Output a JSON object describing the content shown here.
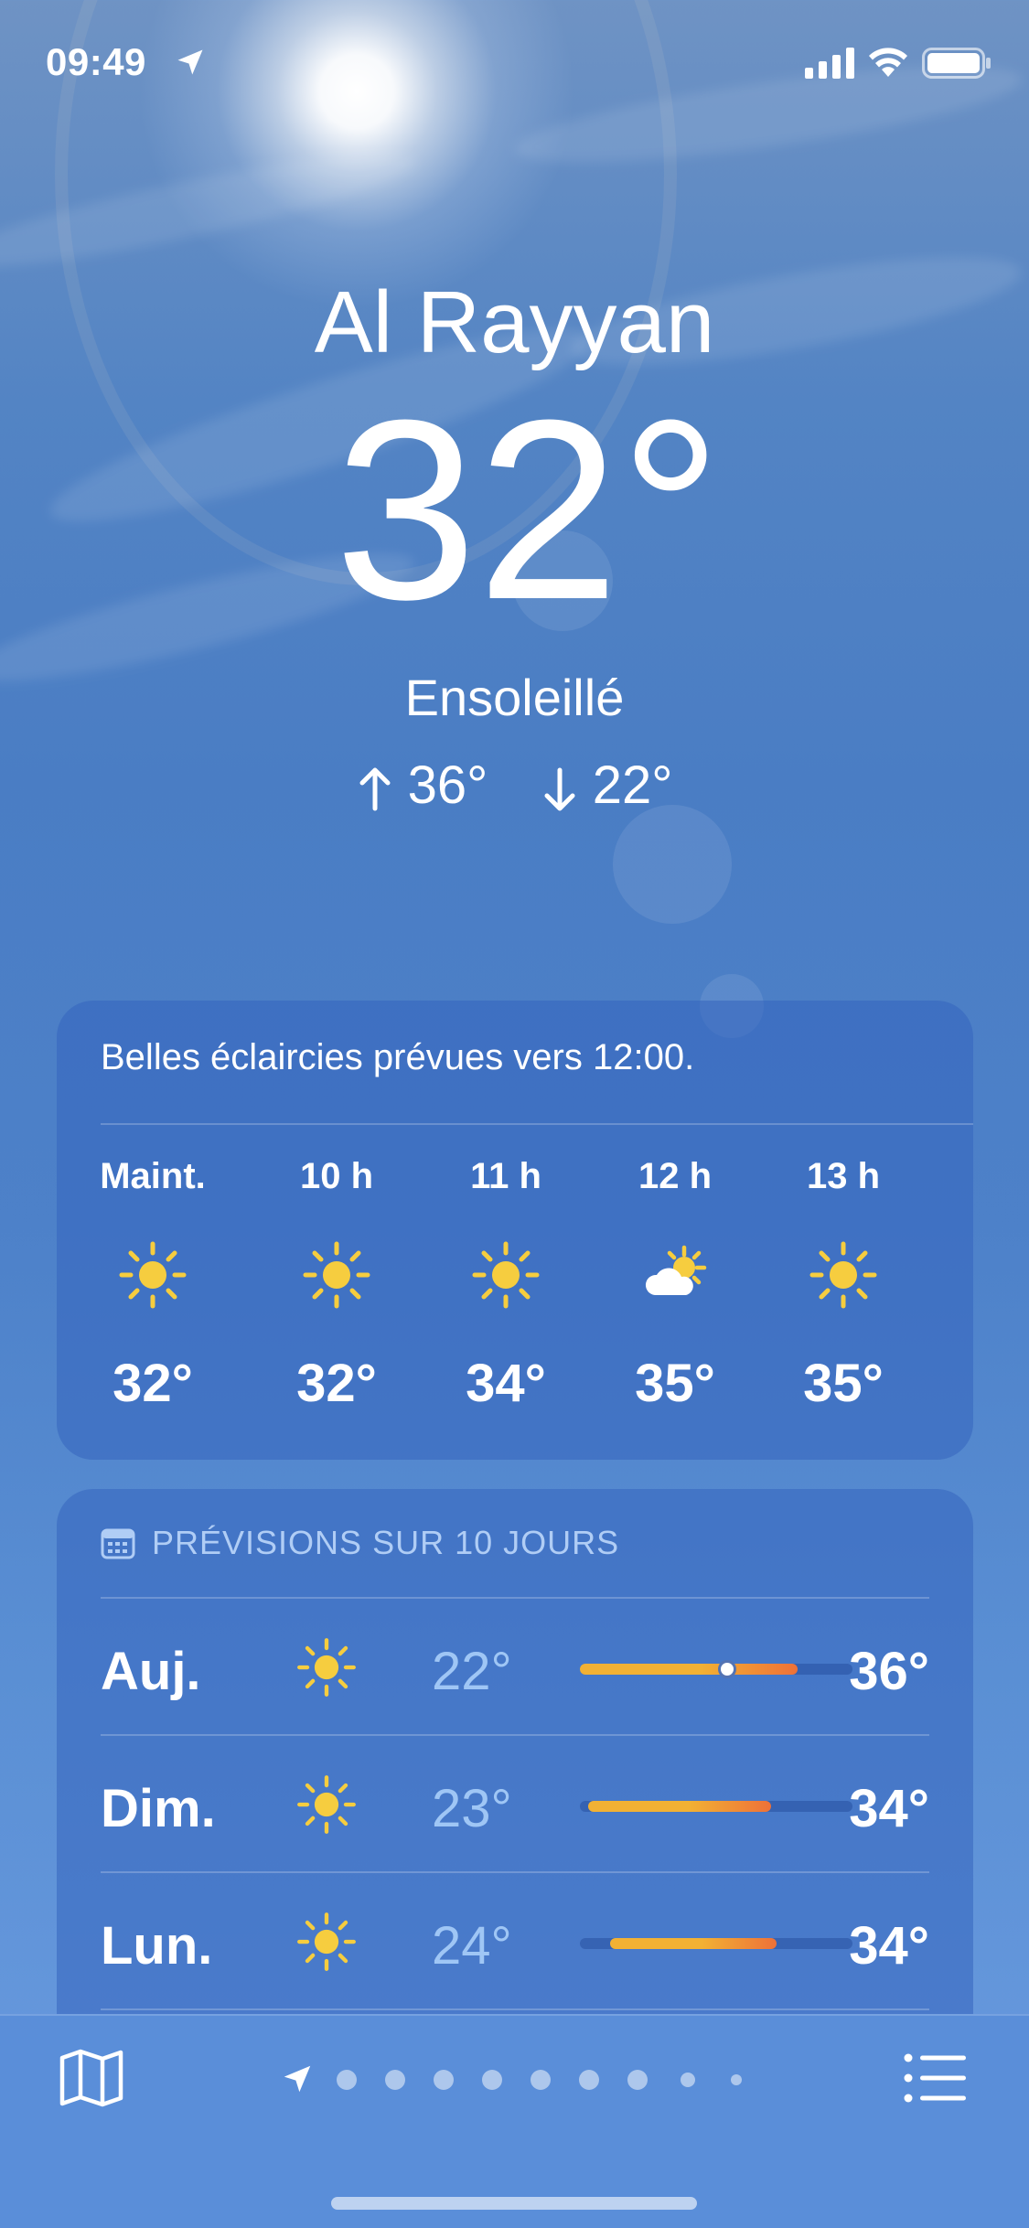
{
  "status_bar": {
    "time": "09:49"
  },
  "header": {
    "city": "Al Rayyan",
    "temperature": "32°",
    "condition": "Ensoleillé",
    "high": "36°",
    "low": "22°"
  },
  "hourly": {
    "summary": "Belles éclaircies prévues vers 12:00.",
    "items": [
      {
        "label": "Maint.",
        "icon": "sun-icon",
        "temp": "32°"
      },
      {
        "label": "10 h",
        "icon": "sun-icon",
        "temp": "32°"
      },
      {
        "label": "11 h",
        "icon": "sun-icon",
        "temp": "34°"
      },
      {
        "label": "12 h",
        "icon": "partly-cloudy-icon",
        "temp": "35°"
      },
      {
        "label": "13 h",
        "icon": "sun-icon",
        "temp": "35°"
      }
    ]
  },
  "daily": {
    "header": "PRÉVISIONS SUR 10 JOURS",
    "items": [
      {
        "day": "Auj.",
        "icon": "sun-icon",
        "low": "22°",
        "high": "36°",
        "bar_start": 0.0,
        "bar_end": 0.8,
        "current": 0.54
      },
      {
        "day": "Dim.",
        "icon": "sun-icon",
        "low": "23°",
        "high": "34°",
        "bar_start": 0.03,
        "bar_end": 0.7
      },
      {
        "day": "Lun.",
        "icon": "sun-icon",
        "low": "24°",
        "high": "34°",
        "bar_start": 0.11,
        "bar_end": 0.72
      }
    ]
  },
  "bottom_bar": {
    "pages": 9,
    "current_page": 0
  },
  "colors": {
    "sun": "#f6cd3f",
    "bar_warm": "#f2b134",
    "bar_hot": "#ee7138",
    "low_text": "#9fc6f5",
    "section_head": "#b0cdf5"
  }
}
